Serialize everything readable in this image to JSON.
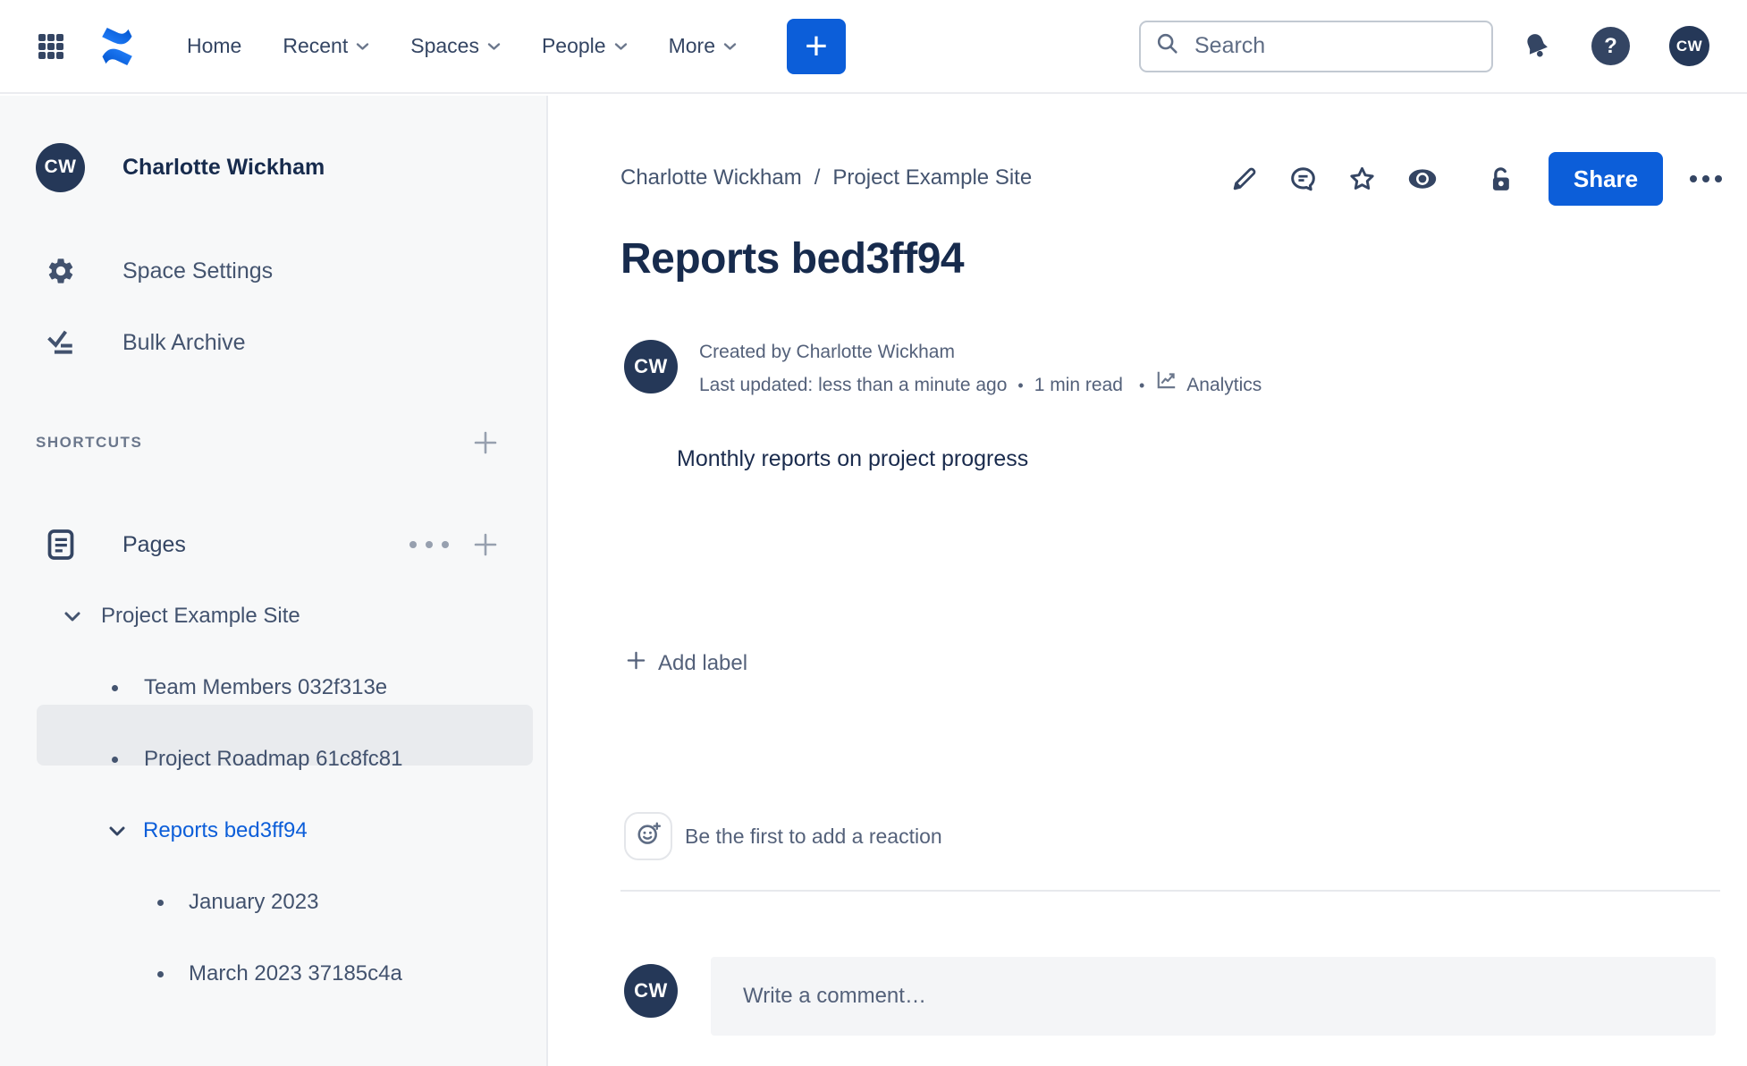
{
  "top_nav": {
    "menu": [
      {
        "label": "Home",
        "dropdown": false
      },
      {
        "label": "Recent",
        "dropdown": true
      },
      {
        "label": "Spaces",
        "dropdown": true
      },
      {
        "label": "People",
        "dropdown": true
      },
      {
        "label": "More",
        "dropdown": true
      }
    ],
    "create_button": "+",
    "search": {
      "placeholder": "Search"
    },
    "user_initials": "CW",
    "icons": [
      "app-grid-icon",
      "confluence-logo",
      "search-icon",
      "bell-icon",
      "help-icon"
    ]
  },
  "sidebar": {
    "user": {
      "initials": "CW",
      "name": "Charlotte Wickham"
    },
    "items": [
      {
        "icon": "gear-icon",
        "label": "Space Settings"
      },
      {
        "icon": "bulk-archive-icon",
        "label": "Bulk Archive"
      }
    ],
    "shortcuts": {
      "label": "SHORTCUTS"
    },
    "pages": {
      "icon": "pages-icon",
      "label": "Pages"
    },
    "tree": [
      {
        "label": "Project Example Site",
        "marker": "chevron",
        "level": 0,
        "selected": false
      },
      {
        "label": "Team Members 032f313e",
        "marker": "bullet",
        "level": 1,
        "selected": false
      },
      {
        "label": "Project Roadmap 61c8fc81",
        "marker": "bullet",
        "level": 1,
        "selected": false
      },
      {
        "label": "Reports bed3ff94",
        "marker": "chevron",
        "level": 1,
        "selected": true
      },
      {
        "label": "January 2023",
        "marker": "bullet",
        "level": 2,
        "selected": false
      },
      {
        "label": "March 2023 37185c4a",
        "marker": "bullet",
        "level": 2,
        "selected": false
      }
    ]
  },
  "content": {
    "breadcrumb": {
      "items": [
        "Charlotte Wickham",
        "Project Example Site"
      ],
      "separator": "/"
    },
    "actions": {
      "share_label": "Share",
      "icons": [
        "edit-icon",
        "comment-icon",
        "star-icon",
        "watch-icon",
        "unlock-icon",
        "more-icon"
      ]
    },
    "title": "Reports bed3ff94",
    "byline": {
      "initials": "CW",
      "created": "Created by Charlotte Wickham",
      "last_updated": "Last updated: less than a minute ago",
      "read_time": "1 min read",
      "analytics": "Analytics",
      "dot": "•"
    },
    "body_text": "Monthly reports on project progress",
    "labels": {
      "add_label": "Add label"
    },
    "reactions": {
      "prompt": "Be the first to add a reaction"
    },
    "comment": {
      "initials": "CW",
      "placeholder": "Write a comment…"
    }
  },
  "colors": {
    "accent_blue": "#0C5ED9",
    "avatar_navy": "#253858",
    "title_navy": "#172B4D",
    "selected_item_bg": "#E9EBEE",
    "sidebar_bg": "#F7F8F9"
  }
}
